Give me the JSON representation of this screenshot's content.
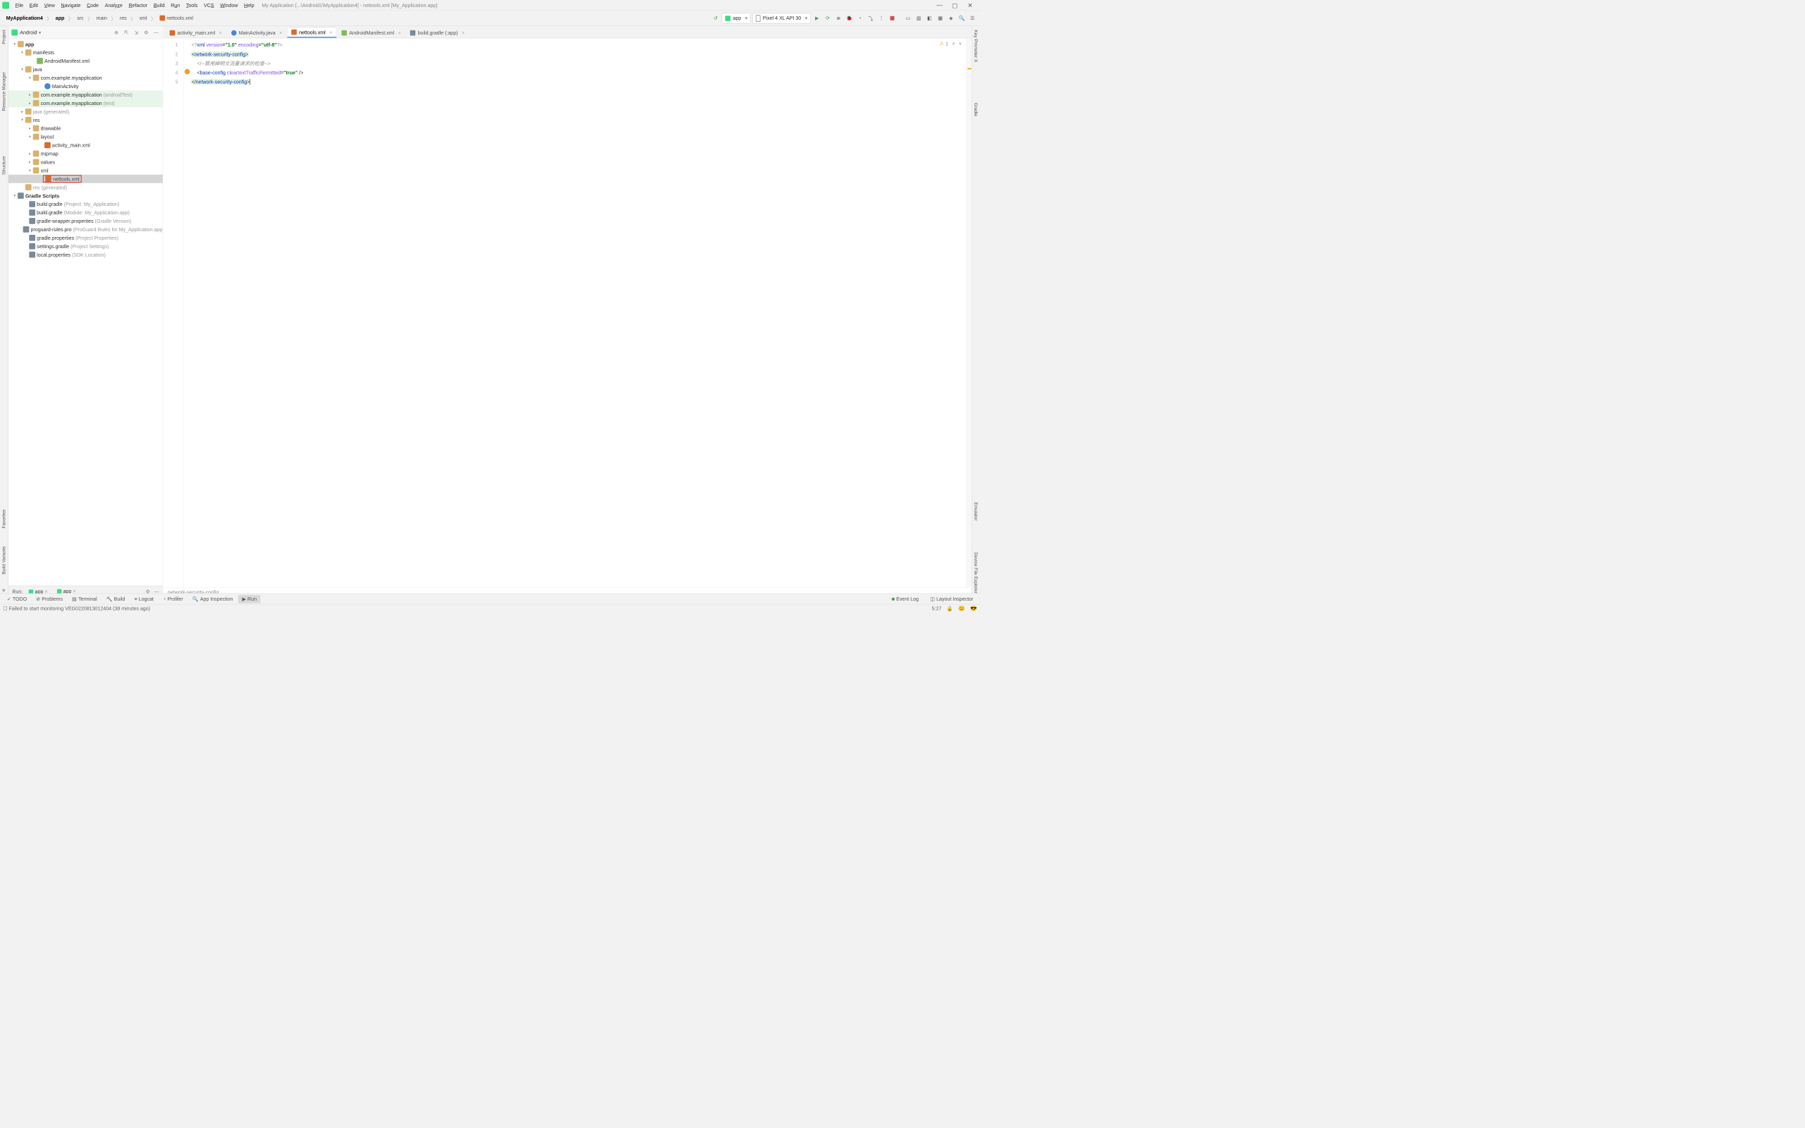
{
  "menu": {
    "items": [
      "File",
      "Edit",
      "View",
      "Navigate",
      "Code",
      "Analyze",
      "Refactor",
      "Build",
      "Run",
      "Tools",
      "VCS",
      "Window",
      "Help"
    ],
    "title": "My Application [...\\Android1\\MyApplication4] - nettools.xml [My_Application.app]"
  },
  "breadcrumbs": [
    "MyApplication4",
    "app",
    "src",
    "main",
    "res",
    "xml",
    "nettools.xml"
  ],
  "runconfig": {
    "module": "app",
    "device": "Pixel 4 XL API 30"
  },
  "projectView": {
    "title": "Android"
  },
  "tree": {
    "app": "app",
    "manifests": "manifests",
    "androidManifest": "AndroidManifest.xml",
    "java": "java",
    "pkg": "com.example.myapplication",
    "mainAct": "MainActivity",
    "pkgAT": "com.example.myapplication",
    "pkgAT_suffix": "(androidTest)",
    "pkgT": "com.example.myapplication",
    "pkgT_suffix": "(test)",
    "javaGen": "java",
    "javaGen_suffix": "(generated)",
    "res": "res",
    "drawable": "drawable",
    "layout": "layout",
    "actMain": "activity_main.xml",
    "mipmap": "mipmap",
    "values": "values",
    "xml": "xml",
    "nettools": "nettools.xml",
    "resGen": "res",
    "resGen_suffix": "(generated)",
    "gradle": "Gradle Scripts",
    "bgP": "build.gradle",
    "bgP_suffix": "(Project: My_Application)",
    "bgM": "build.gradle",
    "bgM_suffix": "(Module: My_Application.app)",
    "gw": "gradle-wrapper.properties",
    "gw_suffix": "(Gradle Version)",
    "pg": "proguard-rules.pro",
    "pg_suffix": "(ProGuard Rules for My_Application.app)",
    "gp": "gradle.properties",
    "gp_suffix": "(Project Properties)",
    "sg": "settings.gradle",
    "sg_suffix": "(Project Settings)",
    "lp": "local.properties",
    "lp_suffix": "(SDK Location)"
  },
  "tabs": [
    {
      "label": "activity_main.xml",
      "ic": "#d86b2d"
    },
    {
      "label": "MainActivity.java",
      "ic": "#4a86cf"
    },
    {
      "label": "nettools.xml",
      "ic": "#d86b2d",
      "active": true
    },
    {
      "label": "AndroidManifest.xml",
      "ic": "#7fba5a"
    },
    {
      "label": "build.gradle (:app)",
      "ic": "#7a8a99"
    }
  ],
  "editor": {
    "warnCount": "1",
    "lines": [
      "1",
      "2",
      "3",
      "4",
      "5"
    ],
    "code": {
      "l1a": "<?",
      "l1b": "xml ",
      "l1c": "version",
      "l1d": "=\"1.0\" ",
      "l1e": "encoding",
      "l1f": "=\"utf-8\"",
      "l1g": "?>",
      "l2": "network-security-config",
      "l3": "<!--禁用掉明文流量请求的检查-->",
      "l4a": "base-config ",
      "l4b": "cleartextTrafficPermitted",
      "l4c": "=",
      "l4d": "\"true\"",
      "l5": "network-security-config"
    },
    "breadcrumb": "network-security-config"
  },
  "run": {
    "label": "Run:",
    "tabs": [
      "app",
      "app"
    ]
  },
  "bottom": {
    "items": [
      "TODO",
      "Problems",
      "Terminal",
      "Build",
      "Logcat",
      "Profiler",
      "App Inspection",
      "Run"
    ],
    "eventLog": "Event Log",
    "layoutInsp": "Layout Inspector"
  },
  "status": {
    "msg": "Failed to start monitoring VEG0220813012404 (38 minutes ago)",
    "pos": "5:27"
  },
  "sidetabs": {
    "left": [
      "Project",
      "Resource Manager",
      "Structure",
      "Favorites",
      "Build Variants"
    ],
    "right": [
      "Key Promoter X",
      "Gradle",
      "Emulator",
      "Device File Explorer"
    ]
  }
}
